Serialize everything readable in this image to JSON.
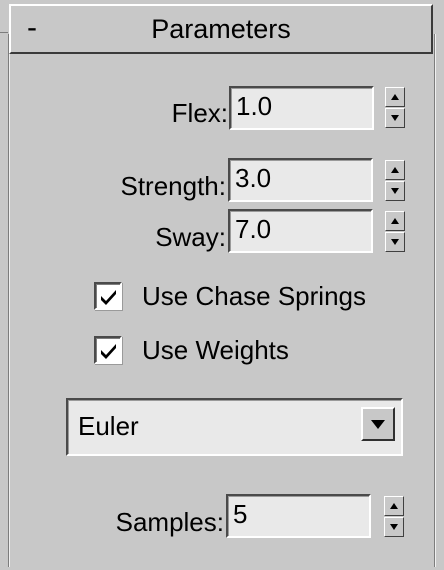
{
  "rollout": {
    "toggle_symbol": "-",
    "title": "Parameters"
  },
  "params": {
    "flex": {
      "label": "Flex:",
      "value": "1.0"
    },
    "strength": {
      "label": "Strength:",
      "value": "3.0"
    },
    "sway": {
      "label": "Sway:",
      "value": "7.0"
    },
    "samples": {
      "label": "Samples:",
      "value": "5"
    }
  },
  "checkboxes": {
    "use_chase_springs": {
      "label": "Use Chase Springs",
      "checked": true
    },
    "use_weights": {
      "label": "Use Weights",
      "checked": true
    }
  },
  "dropdown": {
    "selected": "Euler"
  },
  "icons": {
    "rollout_toggle": "minus-icon",
    "spinner_up": "spinner-up-icon",
    "spinner_down": "spinner-down-icon",
    "checkmark": "checkmark-icon",
    "dropdown_arrow": "chevron-down-icon"
  },
  "colors": {
    "panel_bg": "#c8c8c8",
    "field_bg": "#e9e9e9",
    "text": "#000000"
  }
}
